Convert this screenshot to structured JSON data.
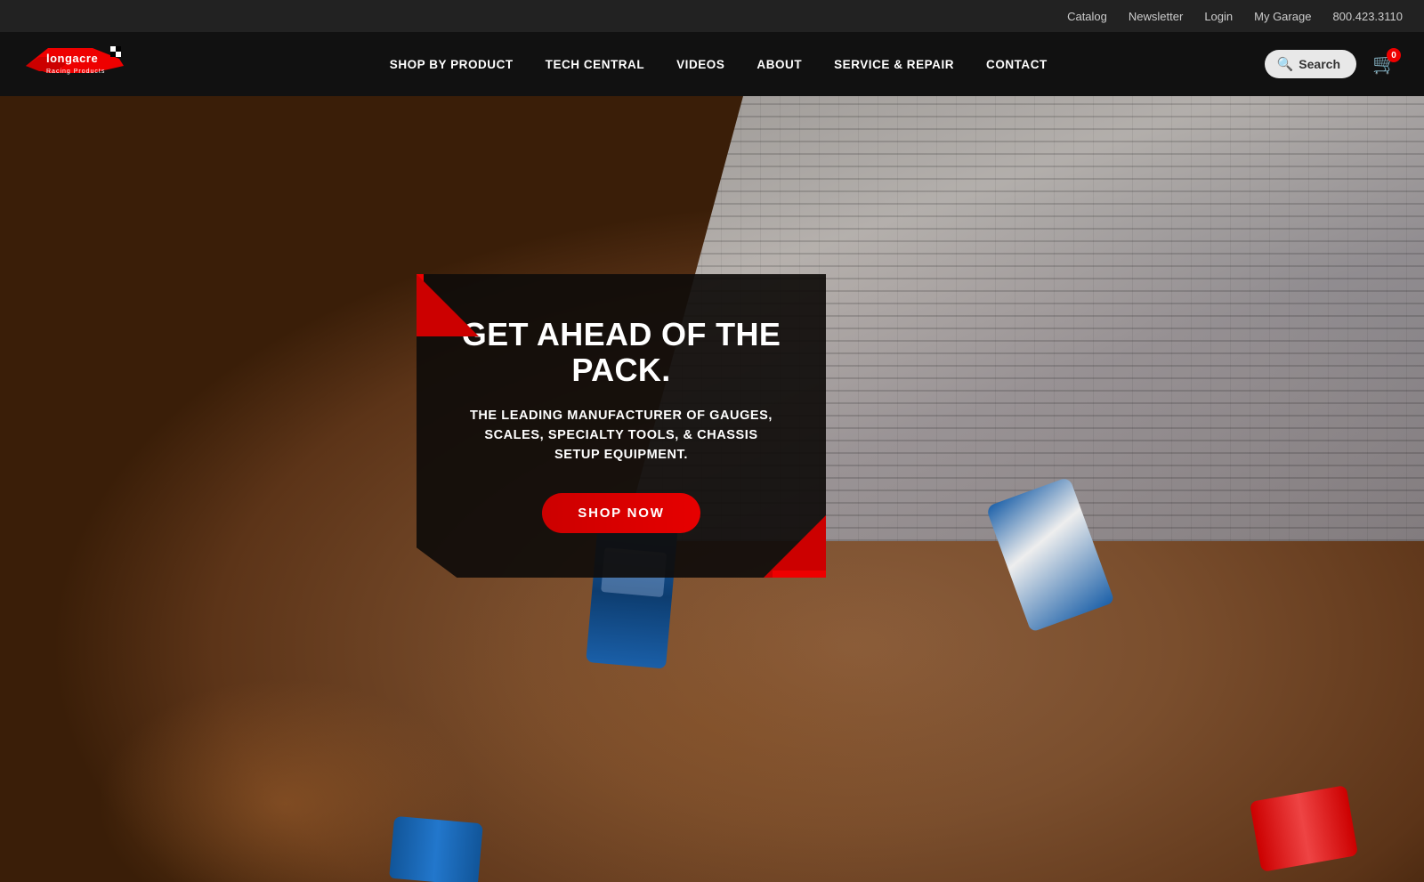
{
  "topbar": {
    "links": [
      {
        "label": "Catalog",
        "name": "catalog-link"
      },
      {
        "label": "Newsletter",
        "name": "newsletter-link"
      },
      {
        "label": "Login",
        "name": "login-link"
      },
      {
        "label": "My Garage",
        "name": "my-garage-link"
      }
    ],
    "phone": "800.423.3110"
  },
  "nav": {
    "logo_alt": "Longacre Racing Products",
    "links": [
      {
        "label": "SHOP BY PRODUCT",
        "name": "shop-by-product-link"
      },
      {
        "label": "TECH CENTRAL",
        "name": "tech-central-link"
      },
      {
        "label": "VIDEOS",
        "name": "videos-link"
      },
      {
        "label": "ABOUT",
        "name": "about-link"
      },
      {
        "label": "SERVICE & REPAIR",
        "name": "service-repair-link"
      },
      {
        "label": "CONTACT",
        "name": "contact-link"
      }
    ],
    "search_label": "Search",
    "cart_badge": "0"
  },
  "hero": {
    "headline": "GET AHEAD OF THE PACK.",
    "subtext": "THE LEADING MANUFACTURER OF\nGAUGES, SCALES, SPECIALTY TOOLS, &\nCHASSIS SETUP EQUIPMENT.",
    "cta_label": "SHOP NOW"
  }
}
